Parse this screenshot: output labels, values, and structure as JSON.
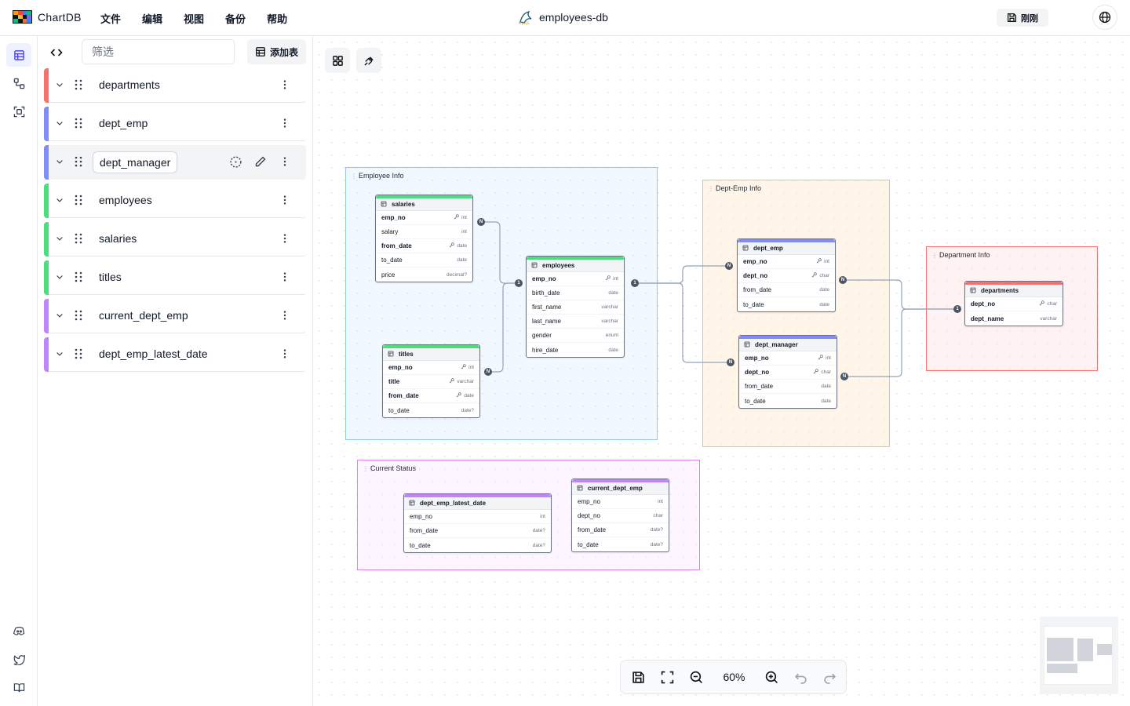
{
  "app": {
    "name": "ChartDB",
    "db_title": "employees-db",
    "saved_label": "刚刚"
  },
  "menu": [
    "文件",
    "编辑",
    "视图",
    "备份",
    "帮助"
  ],
  "rail": {
    "top": [
      "table-icon",
      "relationship-icon",
      "area-icon"
    ],
    "bottom": [
      "discord-icon",
      "twitter-icon",
      "docs-icon"
    ]
  },
  "sidebar": {
    "filter_placeholder": "筛选",
    "add_table_label": "添加表",
    "tables": [
      {
        "name": "departments",
        "color": "#f87171"
      },
      {
        "name": "dept_emp",
        "color": "#818cf8"
      },
      {
        "name": "dept_manager",
        "color": "#818cf8",
        "selected": true
      },
      {
        "name": "employees",
        "color": "#4ade80"
      },
      {
        "name": "salaries",
        "color": "#4ade80"
      },
      {
        "name": "titles",
        "color": "#4ade80"
      },
      {
        "name": "current_dept_emp",
        "color": "#c084fc"
      },
      {
        "name": "dept_emp_latest_date",
        "color": "#c084fc"
      }
    ]
  },
  "areas": {
    "employee_info": {
      "title": "Employee Info",
      "color": "#93c5fd"
    },
    "dept_emp_info": {
      "title": "Dept-Emp Info",
      "color": "#fdba74"
    },
    "department_info": {
      "title": "Department Info",
      "color": "#f87171"
    },
    "current_status": {
      "title": "Current Status",
      "color": "#e879f9"
    }
  },
  "erd_tables": {
    "salaries": {
      "name": "salaries",
      "color": "#4ade80",
      "fields": [
        {
          "name": "emp_no",
          "type": "int",
          "pk": true,
          "key": true
        },
        {
          "name": "salary",
          "type": "int"
        },
        {
          "name": "from_date",
          "type": "date",
          "pk": true,
          "key": true
        },
        {
          "name": "to_date",
          "type": "date"
        },
        {
          "name": "price",
          "type": "decimal?"
        }
      ]
    },
    "titles": {
      "name": "titles",
      "color": "#4ade80",
      "fields": [
        {
          "name": "emp_no",
          "type": "int",
          "pk": true,
          "key": true
        },
        {
          "name": "title",
          "type": "varchar",
          "pk": true,
          "key": true
        },
        {
          "name": "from_date",
          "type": "date",
          "pk": true,
          "key": true
        },
        {
          "name": "to_date",
          "type": "date?"
        }
      ]
    },
    "employees": {
      "name": "employees",
      "color": "#4ade80",
      "fields": [
        {
          "name": "emp_no",
          "type": "int",
          "pk": true,
          "key": true
        },
        {
          "name": "birth_date",
          "type": "date"
        },
        {
          "name": "first_name",
          "type": "varchar"
        },
        {
          "name": "last_name",
          "type": "varchar"
        },
        {
          "name": "gender",
          "type": "enum"
        },
        {
          "name": "hire_date",
          "type": "date"
        }
      ]
    },
    "dept_emp": {
      "name": "dept_emp",
      "color": "#818cf8",
      "fields": [
        {
          "name": "emp_no",
          "type": "int",
          "pk": true,
          "key": true
        },
        {
          "name": "dept_no",
          "type": "char",
          "pk": true,
          "key": true
        },
        {
          "name": "from_date",
          "type": "date"
        },
        {
          "name": "to_date",
          "type": "date"
        }
      ]
    },
    "dept_manager": {
      "name": "dept_manager",
      "color": "#818cf8",
      "fields": [
        {
          "name": "emp_no",
          "type": "int",
          "pk": true,
          "key": true
        },
        {
          "name": "dept_no",
          "type": "char",
          "pk": true,
          "key": true
        },
        {
          "name": "from_date",
          "type": "date"
        },
        {
          "name": "to_date",
          "type": "date"
        }
      ]
    },
    "departments": {
      "name": "departments",
      "color": "#f87171",
      "fields": [
        {
          "name": "dept_no",
          "type": "char",
          "pk": true,
          "key": true
        },
        {
          "name": "dept_name",
          "type": "varchar",
          "pk": true
        }
      ]
    },
    "dept_emp_latest_date": {
      "name": "dept_emp_latest_date",
      "color": "#c084fc",
      "fields": [
        {
          "name": "emp_no",
          "type": "int"
        },
        {
          "name": "from_date",
          "type": "date?"
        },
        {
          "name": "to_date",
          "type": "date?"
        }
      ]
    },
    "current_dept_emp": {
      "name": "current_dept_emp",
      "color": "#c084fc",
      "fields": [
        {
          "name": "emp_no",
          "type": "int"
        },
        {
          "name": "dept_no",
          "type": "char"
        },
        {
          "name": "from_date",
          "type": "date?"
        },
        {
          "name": "to_date",
          "type": "date?"
        }
      ]
    }
  },
  "markers": {
    "one": "1",
    "many": "N"
  },
  "zoom": {
    "value": "60%"
  }
}
